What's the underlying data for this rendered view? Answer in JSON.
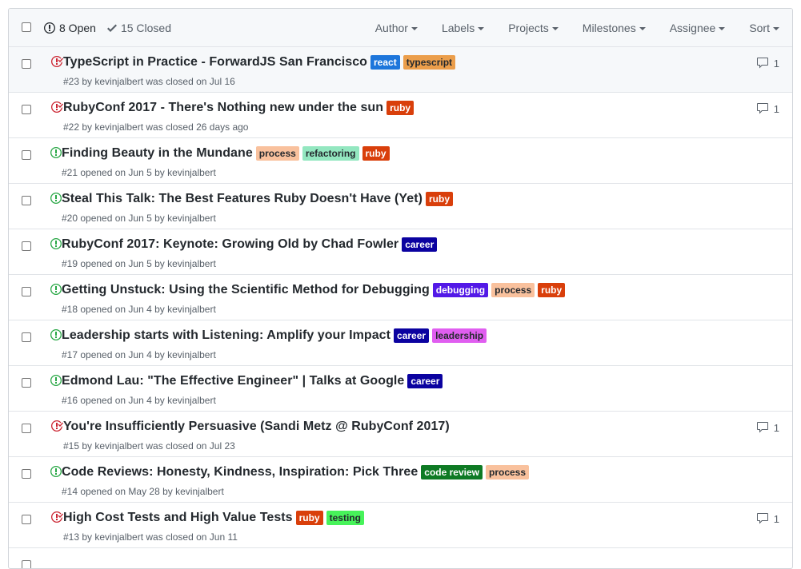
{
  "header": {
    "open_label": "8 Open",
    "closed_label": "15 Closed",
    "filters": [
      "Author",
      "Labels",
      "Projects",
      "Milestones",
      "Assignee",
      "Sort"
    ]
  },
  "colors": {
    "open_icon": "#28a745",
    "closed_icon": "#cb2431"
  },
  "issues": [
    {
      "state": "closed",
      "title": "TypeScript in Practice - ForwardJS San Francisco",
      "meta": "#23 by kevinjalbert was closed on Jul 16",
      "comments": "1",
      "labels": [
        {
          "name": "react",
          "bg": "#1d76db",
          "fg": "#ffffff"
        },
        {
          "name": "typescript",
          "bg": "#eb9e4b",
          "fg": "#24292e"
        }
      ]
    },
    {
      "state": "closed",
      "title": "RubyConf 2017 - There's Nothing new under the sun",
      "meta": "#22 by kevinjalbert was closed 26 days ago",
      "comments": "1",
      "labels": [
        {
          "name": "ruby",
          "bg": "#d93f0b",
          "fg": "#ffffff"
        }
      ]
    },
    {
      "state": "open",
      "title": "Finding Beauty in the Mundane",
      "meta": "#21 opened on Jun 5 by kevinjalbert",
      "comments": "",
      "labels": [
        {
          "name": "process",
          "bg": "#f9c19d",
          "fg": "#24292e"
        },
        {
          "name": "refactoring",
          "bg": "#93e7c0",
          "fg": "#24292e"
        },
        {
          "name": "ruby",
          "bg": "#d93f0b",
          "fg": "#ffffff"
        }
      ]
    },
    {
      "state": "open",
      "title": "Steal This Talk: The Best Features Ruby Doesn't Have (Yet)",
      "meta": "#20 opened on Jun 5 by kevinjalbert",
      "comments": "",
      "labels": [
        {
          "name": "ruby",
          "bg": "#d93f0b",
          "fg": "#ffffff"
        }
      ]
    },
    {
      "state": "open",
      "title": "RubyConf 2017: Keynote: Growing Old by Chad Fowler",
      "meta": "#19 opened on Jun 5 by kevinjalbert",
      "comments": "",
      "labels": [
        {
          "name": "career",
          "bg": "#0b02a0",
          "fg": "#ffffff"
        }
      ]
    },
    {
      "state": "open",
      "title": "Getting Unstuck: Using the Scientific Method for Debugging",
      "meta": "#18 opened on Jun 4 by kevinjalbert",
      "comments": "",
      "labels": [
        {
          "name": "debugging",
          "bg": "#5319e7",
          "fg": "#ffffff"
        },
        {
          "name": "process",
          "bg": "#f9c19d",
          "fg": "#24292e"
        },
        {
          "name": "ruby",
          "bg": "#d93f0b",
          "fg": "#ffffff"
        }
      ]
    },
    {
      "state": "open",
      "title": "Leadership starts with Listening: Amplify your Impact",
      "meta": "#17 opened on Jun 4 by kevinjalbert",
      "comments": "",
      "labels": [
        {
          "name": "career",
          "bg": "#0b02a0",
          "fg": "#ffffff"
        },
        {
          "name": "leadership",
          "bg": "#e05ef0",
          "fg": "#24292e"
        }
      ]
    },
    {
      "state": "open",
      "title": "Edmond Lau: \"The Effective Engineer\" | Talks at Google",
      "meta": "#16 opened on Jun 4 by kevinjalbert",
      "comments": "",
      "labels": [
        {
          "name": "career",
          "bg": "#0b02a0",
          "fg": "#ffffff"
        }
      ]
    },
    {
      "state": "closed",
      "title": "You're Insufficiently Persuasive (Sandi Metz @ RubyConf 2017)",
      "meta": "#15 by kevinjalbert was closed on Jul 23",
      "comments": "1",
      "labels": []
    },
    {
      "state": "open",
      "title": "Code Reviews: Honesty, Kindness, Inspiration: Pick Three",
      "meta": "#14 opened on May 28 by kevinjalbert",
      "comments": "",
      "labels": [
        {
          "name": "code review",
          "bg": "#0e7a24",
          "fg": "#ffffff"
        },
        {
          "name": "process",
          "bg": "#f9c19d",
          "fg": "#24292e"
        }
      ]
    },
    {
      "state": "closed",
      "title": "High Cost Tests and High Value Tests",
      "meta": "#13 by kevinjalbert was closed on Jun 11",
      "comments": "1",
      "labels": [
        {
          "name": "ruby",
          "bg": "#d93f0b",
          "fg": "#ffffff"
        },
        {
          "name": "testing",
          "bg": "#47f35a",
          "fg": "#24292e"
        }
      ]
    },
    {
      "state": "open",
      "title": "",
      "meta": "",
      "comments": "",
      "labels": []
    }
  ]
}
